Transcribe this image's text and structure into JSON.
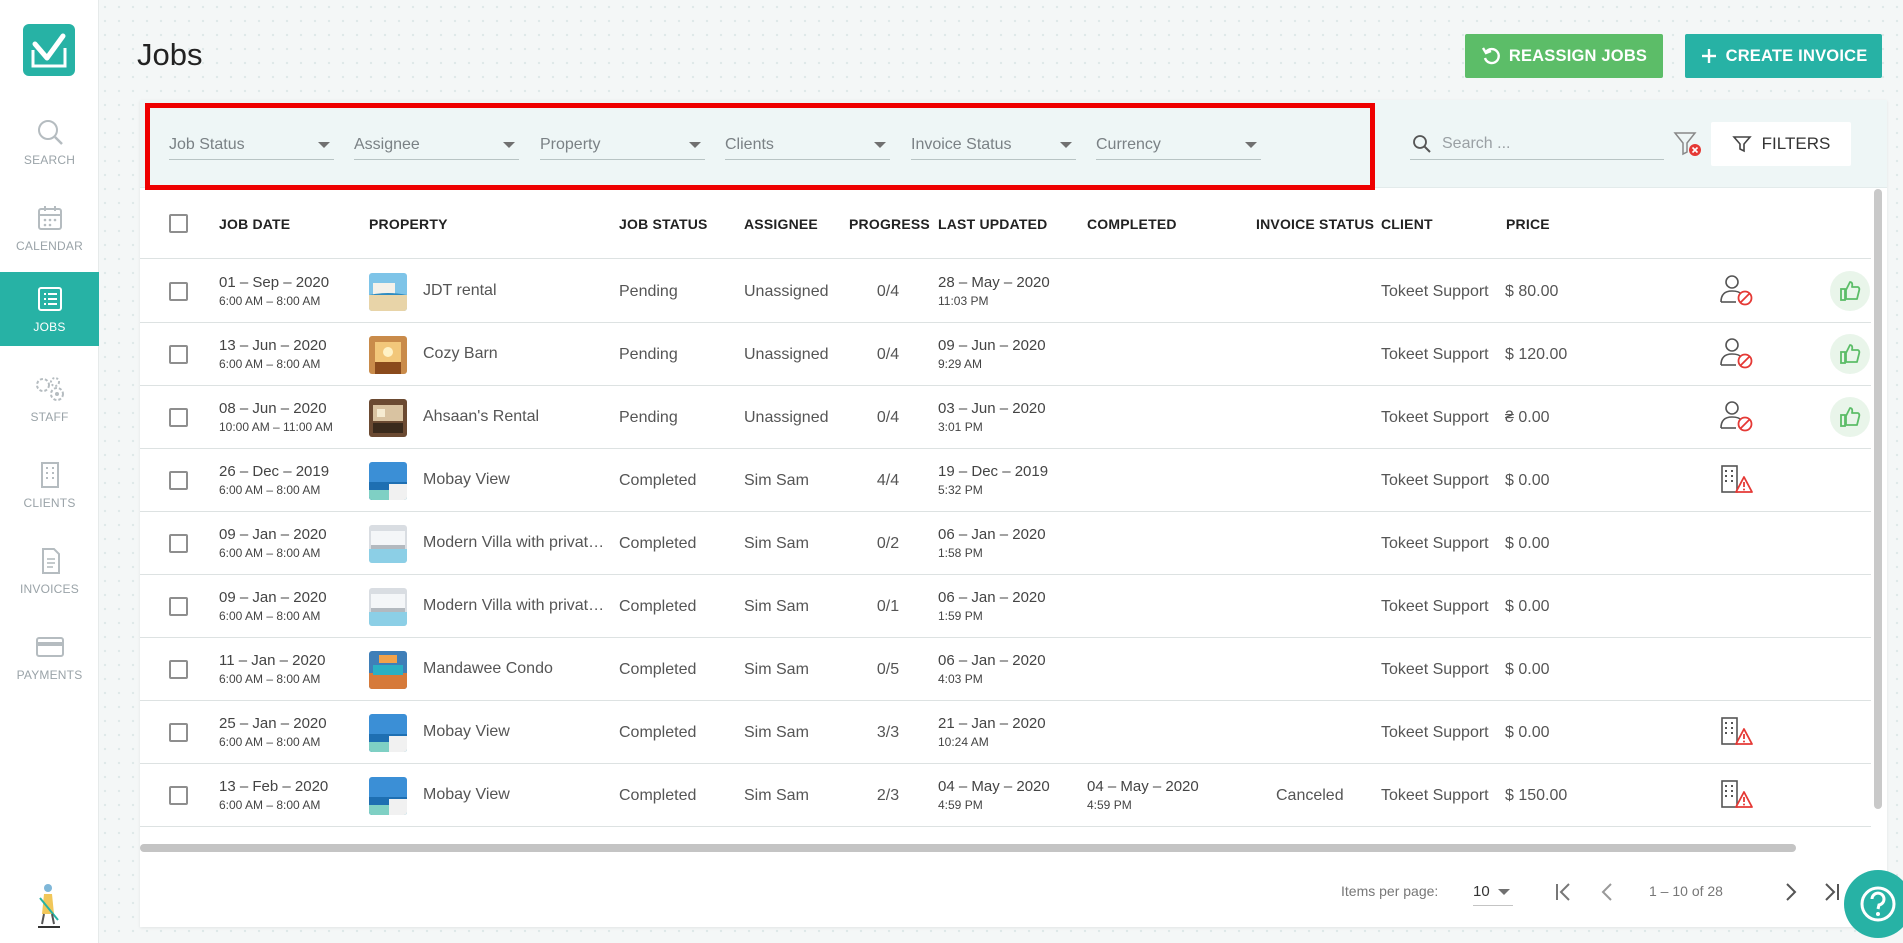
{
  "page": {
    "title": "Jobs"
  },
  "sidebar": {
    "items": [
      {
        "label": "SEARCH",
        "icon": "search-icon"
      },
      {
        "label": "CALENDAR",
        "icon": "calendar-icon"
      },
      {
        "label": "JOBS",
        "icon": "list-icon",
        "active": true
      },
      {
        "label": "STAFF",
        "icon": "staff-gears-icon"
      },
      {
        "label": "CLIENTS",
        "icon": "building-icon"
      },
      {
        "label": "INVOICES",
        "icon": "document-icon"
      },
      {
        "label": "PAYMENTS",
        "icon": "card-icon"
      }
    ]
  },
  "header": {
    "reassign_label": "REASSIGN JOBS",
    "invoice_label": "CREATE INVOICE"
  },
  "filters": {
    "job_status": "Job Status",
    "assignee": "Assignee",
    "property": "Property",
    "clients": "Clients",
    "invoice_status": "Invoice Status",
    "currency": "Currency",
    "search_placeholder": "Search ...",
    "filters_label": "FILTERS"
  },
  "table": {
    "columns": {
      "job_date": "JOB DATE",
      "property": "PROPERTY",
      "job_status": "JOB STATUS",
      "assignee": "ASSIGNEE",
      "progress": "PROGRESS",
      "last_updated": "LAST UPDATED",
      "completed": "COMPLETED",
      "invoice_status": "INVOICE STATUS",
      "client": "CLIENT",
      "price": "PRICE"
    },
    "rows": [
      {
        "date": "01 – Sep – 2020",
        "time": "6:00 AM – 8:00 AM",
        "property": "JDT rental",
        "thumb": "beach",
        "status": "Pending",
        "assignee": "Unassigned",
        "progress": "0/4",
        "updated_date": "28 – May – 2020",
        "updated_time": "11:03 PM",
        "completed_date": "",
        "completed_time": "",
        "invoice_status": "",
        "client": "Tokeet Support",
        "price": "$ 80.00",
        "indicator": "user-blocked-icon",
        "like": true
      },
      {
        "date": "13 – Jun – 2020",
        "time": "6:00 AM – 8:00 AM",
        "property": "Cozy Barn",
        "thumb": "barn",
        "status": "Pending",
        "assignee": "Unassigned",
        "progress": "0/4",
        "updated_date": "09 – Jun – 2020",
        "updated_time": "9:29 AM",
        "completed_date": "",
        "completed_time": "",
        "invoice_status": "",
        "client": "Tokeet Support",
        "price": "$ 120.00",
        "indicator": "user-blocked-icon",
        "like": true
      },
      {
        "date": "08 – Jun – 2020",
        "time": "10:00 AM – 11:00 AM",
        "property": "Ahsaan's Rental",
        "thumb": "room",
        "status": "Pending",
        "assignee": "Unassigned",
        "progress": "0/4",
        "updated_date": "03 – Jun – 2020",
        "updated_time": "3:01 PM",
        "completed_date": "",
        "completed_time": "",
        "invoice_status": "",
        "client": "Tokeet Support",
        "price": "₴ 0.00",
        "indicator": "user-blocked-icon",
        "like": true
      },
      {
        "date": "26 – Dec – 2019",
        "time": "6:00 AM – 8:00 AM",
        "property": "Mobay View",
        "thumb": "ocean",
        "status": "Completed",
        "assignee": "Sim Sam",
        "progress": "4/4",
        "updated_date": "19 – Dec – 2019",
        "updated_time": "5:32 PM",
        "completed_date": "",
        "completed_time": "",
        "invoice_status": "",
        "client": "Tokeet Support",
        "price": "$ 0.00",
        "indicator": "building-warning-icon",
        "like": false
      },
      {
        "date": "09 – Jan – 2020",
        "time": "6:00 AM – 8:00 AM",
        "property": "Modern Villa with private pool",
        "thumb": "villa",
        "status": "Completed",
        "assignee": "Sim Sam",
        "progress": "0/2",
        "updated_date": "06 – Jan – 2020",
        "updated_time": "1:58 PM",
        "completed_date": "",
        "completed_time": "",
        "invoice_status": "",
        "client": "Tokeet Support",
        "price": "$ 0.00",
        "indicator": "",
        "like": false
      },
      {
        "date": "09 – Jan – 2020",
        "time": "6:00 AM – 8:00 AM",
        "property": "Modern Villa with private pool",
        "thumb": "villa",
        "status": "Completed",
        "assignee": "Sim Sam",
        "progress": "0/1",
        "updated_date": "06 – Jan – 2020",
        "updated_time": "1:59 PM",
        "completed_date": "",
        "completed_time": "",
        "invoice_status": "",
        "client": "Tokeet Support",
        "price": "$ 0.00",
        "indicator": "",
        "like": false
      },
      {
        "date": "11 – Jan – 2020",
        "time": "6:00 AM – 8:00 AM",
        "property": "Mandawee Condo",
        "thumb": "condo",
        "status": "Completed",
        "assignee": "Sim Sam",
        "progress": "0/5",
        "updated_date": "06 – Jan – 2020",
        "updated_time": "4:03 PM",
        "completed_date": "",
        "completed_time": "",
        "invoice_status": "",
        "client": "Tokeet Support",
        "price": "$ 0.00",
        "indicator": "",
        "like": false
      },
      {
        "date": "25 – Jan – 2020",
        "time": "6:00 AM – 8:00 AM",
        "property": "Mobay View",
        "thumb": "ocean",
        "status": "Completed",
        "assignee": "Sim Sam",
        "progress": "3/3",
        "updated_date": "21 – Jan – 2020",
        "updated_time": "10:24 AM",
        "completed_date": "",
        "completed_time": "",
        "invoice_status": "",
        "client": "Tokeet Support",
        "price": "$ 0.00",
        "indicator": "building-warning-icon",
        "like": false
      },
      {
        "date": "13 – Feb – 2020",
        "time": "6:00 AM – 8:00 AM",
        "property": "Mobay View",
        "thumb": "ocean",
        "status": "Completed",
        "assignee": "Sim Sam",
        "progress": "2/3",
        "updated_date": "04 – May – 2020",
        "updated_time": "4:59 PM",
        "completed_date": "04 – May – 2020",
        "completed_time": "4:59 PM",
        "invoice_status": "Canceled",
        "client": "Tokeet Support",
        "price": "$ 150.00",
        "indicator": "building-warning-icon",
        "like": false
      }
    ]
  },
  "paginator": {
    "items_per_page_label": "Items per page:",
    "items_per_page": "10",
    "range": "1 – 10 of 28"
  },
  "colors": {
    "brand": "#27b2a5",
    "reassign": "#5cbd68",
    "highlight": "#ee0000"
  }
}
